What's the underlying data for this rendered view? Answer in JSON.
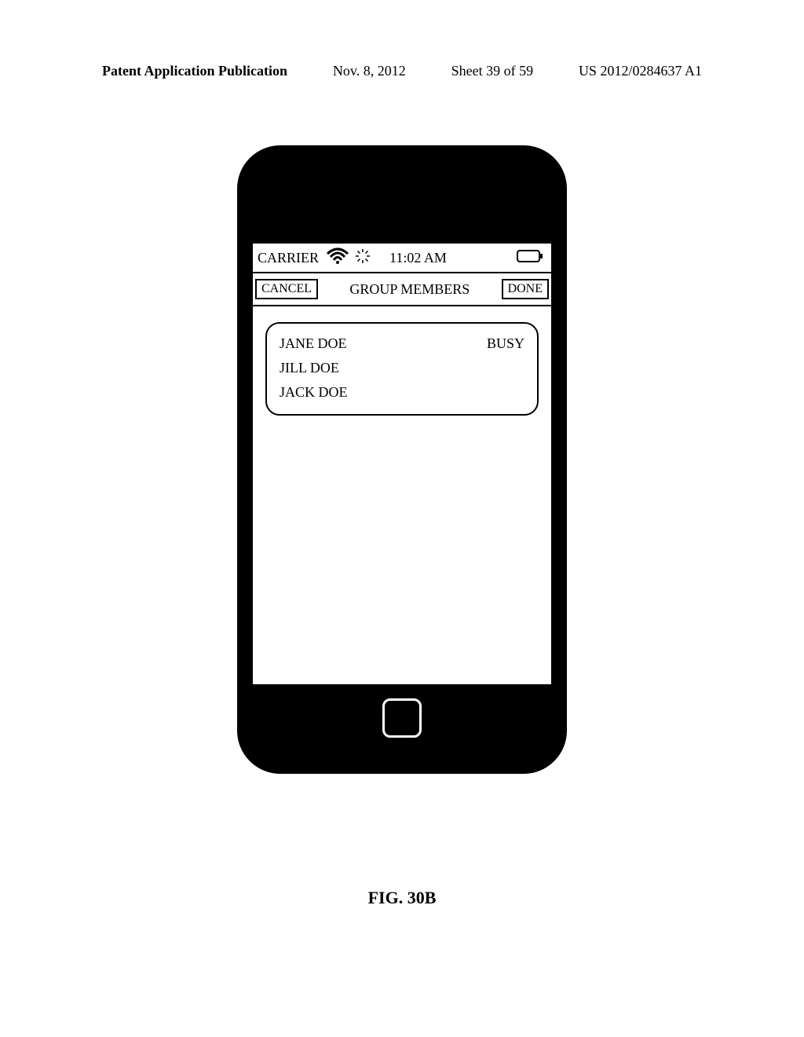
{
  "header": {
    "publication_label": "Patent Application Publication",
    "date": "Nov. 8, 2012",
    "sheet": "Sheet 39 of 59",
    "doc_number": "US 2012/0284637 A1"
  },
  "figure_label": "FIG. 30B",
  "status": {
    "carrier": "CARRIER",
    "time": "11:02 AM"
  },
  "nav": {
    "cancel": "CANCEL",
    "title": "GROUP MEMBERS",
    "done": "DONE"
  },
  "members": [
    {
      "name": "JANE DOE",
      "status": "BUSY"
    },
    {
      "name": "JILL DOE",
      "status": ""
    },
    {
      "name": "JACK DOE",
      "status": ""
    }
  ]
}
